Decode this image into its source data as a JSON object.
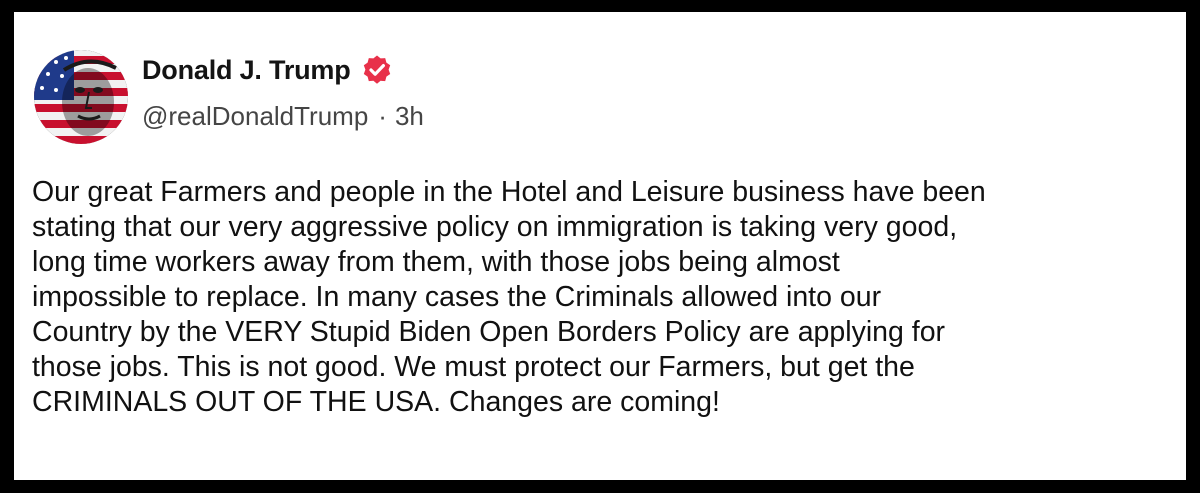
{
  "post": {
    "author": {
      "display_name": "Donald J. Trump",
      "handle": "@realDonaldTrump",
      "verified_icon": "verified-badge-icon",
      "avatar": "american-flag-portrait-avatar"
    },
    "separator": "·",
    "time_ago": "3h",
    "body": "Our great Farmers and people in the Hotel and Leisure business have been\nstating that our very aggressive policy on immigration is taking very good,\nlong time workers away from them, with those jobs being almost\nimpossible to replace. In many cases the Criminals allowed into our\nCountry by the VERY Stupid Biden Open Borders Policy are applying for\nthose jobs. This is not good. We must protect our Farmers, but get the\nCRIMINALS OUT OF THE USA. Changes are coming!"
  },
  "colors": {
    "frame": "#000000",
    "background": "#ffffff",
    "text": "#111111",
    "secondary_text": "#454545",
    "verified_badge": "#e8314a"
  }
}
